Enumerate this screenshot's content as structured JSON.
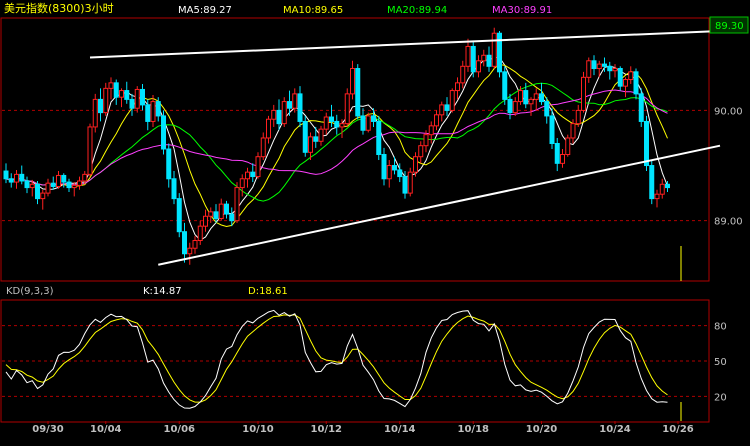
{
  "header": {
    "title": "美元指数(8300)3小时",
    "ma_labels": [
      {
        "text": "MA5:89.27",
        "color": "#ffffff"
      },
      {
        "text": "MA10:89.65",
        "color": "#ffff00"
      },
      {
        "text": "MA20:89.94",
        "color": "#00ff00"
      },
      {
        "text": "MA30:89.91",
        "color": "#ff40ff"
      }
    ]
  },
  "kd": {
    "label": "KD(9,3,3)",
    "k_label": "K:14.87",
    "d_label": "D:18.61"
  },
  "colors": {
    "background": "#000000",
    "frame": "#b00000",
    "grid": "#b00000",
    "axis_text": "#c0c0c0",
    "up_candle": "#ff2020",
    "down_candle": "#00e5ff",
    "ma5": "#ffffff",
    "ma10": "#ffff00",
    "ma20": "#00ff00",
    "ma30": "#ff40ff",
    "trendline": "#ffffff",
    "k_line": "#ffffff",
    "d_line": "#ffff00",
    "volume_bar": "#ffff00"
  },
  "chart_data": [
    {
      "type": "candlestick",
      "title": "美元指数(8300)3小时",
      "x_ticks": [
        "09/30",
        "10/04",
        "10/06",
        "10/10",
        "10/12",
        "10/14",
        "10/18",
        "10/20",
        "10/24",
        "10/26"
      ],
      "x_tick_index": [
        8,
        19,
        33,
        48,
        61,
        75,
        89,
        102,
        116,
        128
      ],
      "y_ticks": [
        90.0,
        89.0
      ],
      "y_tick_labels": [
        "90.00",
        "89.00"
      ],
      "price_marker": "89.30",
      "ylim": [
        88.48,
        90.82
      ],
      "ohlc": [
        [
          89.45,
          89.52,
          89.34,
          89.38
        ],
        [
          89.38,
          89.43,
          89.3,
          89.35
        ],
        [
          89.35,
          89.46,
          89.29,
          89.42
        ],
        [
          89.42,
          89.5,
          89.33,
          89.36
        ],
        [
          89.36,
          89.4,
          89.25,
          89.3
        ],
        [
          89.3,
          89.37,
          89.22,
          89.33
        ],
        [
          89.33,
          89.36,
          89.15,
          89.2
        ],
        [
          89.2,
          89.28,
          89.1,
          89.25
        ],
        [
          89.25,
          89.38,
          89.22,
          89.34
        ],
        [
          89.34,
          89.4,
          89.28,
          89.31
        ],
        [
          89.31,
          89.45,
          89.29,
          89.41
        ],
        [
          89.41,
          89.43,
          89.3,
          89.35
        ],
        [
          89.35,
          89.38,
          89.26,
          89.3
        ],
        [
          89.3,
          89.35,
          89.22,
          89.32
        ],
        [
          89.32,
          89.4,
          89.28,
          89.36
        ],
        [
          89.36,
          89.45,
          89.33,
          89.42
        ],
        [
          89.42,
          89.88,
          89.4,
          89.85
        ],
        [
          89.85,
          90.15,
          89.8,
          90.1
        ],
        [
          90.1,
          90.2,
          89.9,
          89.98
        ],
        [
          89.98,
          90.25,
          89.95,
          90.2
        ],
        [
          90.2,
          90.3,
          90.1,
          90.25
        ],
        [
          90.25,
          90.28,
          90.05,
          90.12
        ],
        [
          90.12,
          90.2,
          90.03,
          90.18
        ],
        [
          90.18,
          90.26,
          90.06,
          90.1
        ],
        [
          90.1,
          90.15,
          89.95,
          90.02
        ],
        [
          90.02,
          90.22,
          89.98,
          90.19
        ],
        [
          90.19,
          90.24,
          90.0,
          90.05
        ],
        [
          90.05,
          90.1,
          89.82,
          89.9
        ],
        [
          89.9,
          90.14,
          89.85,
          90.08
        ],
        [
          90.08,
          90.12,
          89.9,
          89.95
        ],
        [
          89.95,
          90.0,
          89.6,
          89.65
        ],
        [
          89.65,
          89.7,
          89.3,
          89.38
        ],
        [
          89.38,
          89.45,
          89.15,
          89.2
        ],
        [
          89.2,
          89.25,
          88.85,
          88.9
        ],
        [
          88.9,
          88.98,
          88.62,
          88.7
        ],
        [
          88.7,
          88.8,
          88.6,
          88.75
        ],
        [
          88.75,
          88.86,
          88.7,
          88.82
        ],
        [
          88.82,
          89.0,
          88.78,
          88.95
        ],
        [
          88.95,
          89.1,
          88.9,
          89.04
        ],
        [
          89.04,
          89.12,
          88.98,
          89.08
        ],
        [
          89.08,
          89.15,
          88.98,
          89.02
        ],
        [
          89.02,
          89.2,
          89.0,
          89.15
        ],
        [
          89.15,
          89.18,
          89.02,
          89.06
        ],
        [
          89.06,
          89.12,
          88.95,
          89.0
        ],
        [
          89.0,
          89.35,
          88.98,
          89.3
        ],
        [
          89.3,
          89.42,
          89.22,
          89.38
        ],
        [
          89.38,
          89.48,
          89.3,
          89.44
        ],
        [
          89.44,
          89.52,
          89.35,
          89.4
        ],
        [
          89.4,
          89.62,
          89.38,
          89.58
        ],
        [
          89.58,
          89.8,
          89.55,
          89.75
        ],
        [
          89.75,
          89.95,
          89.7,
          89.92
        ],
        [
          89.92,
          90.05,
          89.85,
          90.0
        ],
        [
          90.0,
          90.1,
          89.82,
          89.88
        ],
        [
          89.88,
          90.12,
          89.85,
          90.08
        ],
        [
          90.08,
          90.18,
          89.95,
          90.02
        ],
        [
          90.02,
          90.2,
          89.98,
          90.15
        ],
        [
          90.15,
          90.22,
          89.85,
          89.9
        ],
        [
          89.9,
          89.95,
          89.58,
          89.62
        ],
        [
          89.62,
          89.8,
          89.55,
          89.76
        ],
        [
          89.76,
          89.85,
          89.66,
          89.72
        ],
        [
          89.72,
          89.86,
          89.68,
          89.83
        ],
        [
          89.83,
          89.98,
          89.78,
          89.94
        ],
        [
          89.94,
          90.05,
          89.85,
          89.9
        ],
        [
          89.9,
          89.96,
          89.78,
          89.85
        ],
        [
          89.85,
          89.92,
          89.75,
          89.88
        ],
        [
          89.88,
          90.2,
          89.85,
          90.15
        ],
        [
          90.15,
          90.45,
          90.1,
          90.38
        ],
        [
          90.38,
          90.42,
          89.92,
          89.95
        ],
        [
          89.95,
          90.02,
          89.78,
          89.82
        ],
        [
          89.82,
          89.98,
          89.8,
          89.95
        ],
        [
          89.95,
          90.02,
          89.85,
          89.9
        ],
        [
          89.9,
          89.95,
          89.55,
          89.6
        ],
        [
          89.6,
          89.66,
          89.32,
          89.38
        ],
        [
          89.38,
          89.55,
          89.3,
          89.5
        ],
        [
          89.5,
          89.58,
          89.42,
          89.46
        ],
        [
          89.46,
          89.52,
          89.35,
          89.4
        ],
        [
          89.4,
          89.45,
          89.2,
          89.25
        ],
        [
          89.25,
          89.48,
          89.22,
          89.44
        ],
        [
          89.44,
          89.62,
          89.4,
          89.58
        ],
        [
          89.58,
          89.72,
          89.52,
          89.68
        ],
        [
          89.68,
          89.82,
          89.62,
          89.78
        ],
        [
          89.78,
          89.9,
          89.7,
          89.86
        ],
        [
          89.86,
          90.0,
          89.82,
          89.96
        ],
        [
          89.96,
          90.08,
          89.9,
          90.05
        ],
        [
          90.05,
          90.12,
          89.95,
          90.0
        ],
        [
          90.0,
          90.2,
          89.98,
          90.18
        ],
        [
          90.18,
          90.3,
          90.1,
          90.25
        ],
        [
          90.25,
          90.45,
          90.2,
          90.4
        ],
        [
          90.4,
          90.65,
          90.35,
          90.58
        ],
        [
          90.58,
          90.62,
          90.3,
          90.35
        ],
        [
          90.35,
          90.5,
          90.3,
          90.45
        ],
        [
          90.45,
          90.55,
          90.4,
          90.5
        ],
        [
          90.5,
          90.58,
          90.35,
          90.4
        ],
        [
          90.4,
          90.75,
          90.38,
          90.7
        ],
        [
          90.7,
          90.72,
          90.3,
          90.35
        ],
        [
          90.35,
          90.4,
          90.05,
          90.1
        ],
        [
          90.1,
          90.15,
          89.92,
          89.98
        ],
        [
          89.98,
          90.12,
          89.95,
          90.08
        ],
        [
          90.08,
          90.22,
          90.05,
          90.18
        ],
        [
          90.18,
          90.25,
          90.02,
          90.06
        ],
        [
          90.06,
          90.12,
          89.95,
          90.1
        ],
        [
          90.1,
          90.2,
          90.0,
          90.15
        ],
        [
          90.15,
          90.25,
          90.05,
          90.08
        ],
        [
          90.08,
          90.12,
          89.88,
          89.95
        ],
        [
          89.95,
          90.02,
          89.65,
          89.7
        ],
        [
          89.7,
          89.75,
          89.45,
          89.52
        ],
        [
          89.52,
          89.65,
          89.48,
          89.6
        ],
        [
          89.6,
          89.78,
          89.58,
          89.75
        ],
        [
          89.75,
          89.92,
          89.7,
          89.88
        ],
        [
          89.88,
          90.05,
          89.85,
          90.0
        ],
        [
          90.0,
          90.35,
          89.98,
          90.3
        ],
        [
          90.3,
          90.48,
          90.25,
          90.45
        ],
        [
          90.45,
          90.5,
          90.32,
          90.38
        ],
        [
          90.38,
          90.45,
          90.3,
          90.42
        ],
        [
          90.42,
          90.48,
          90.35,
          90.4
        ],
        [
          90.4,
          90.44,
          90.28,
          90.36
        ],
        [
          90.36,
          90.42,
          90.3,
          90.38
        ],
        [
          90.38,
          90.4,
          90.18,
          90.22
        ],
        [
          90.22,
          90.3,
          90.12,
          90.28
        ],
        [
          90.28,
          90.4,
          90.24,
          90.35
        ],
        [
          90.35,
          90.38,
          90.1,
          90.15
        ],
        [
          90.15,
          90.2,
          89.85,
          89.9
        ],
        [
          89.9,
          89.95,
          89.45,
          89.5
        ],
        [
          89.5,
          89.55,
          89.15,
          89.2
        ],
        [
          89.2,
          89.28,
          89.12,
          89.24
        ],
        [
          89.24,
          89.38,
          89.2,
          89.33
        ],
        [
          89.33,
          89.36,
          89.26,
          89.3
        ]
      ],
      "ma_series": [
        {
          "name": "MA5",
          "period": 5,
          "last": 89.27
        },
        {
          "name": "MA10",
          "period": 10,
          "last": 89.65
        },
        {
          "name": "MA20",
          "period": 20,
          "last": 89.94
        },
        {
          "name": "MA30",
          "period": 30,
          "last": 89.91
        }
      ],
      "trendlines": [
        {
          "x1": 16,
          "y1": 90.48,
          "x2": 136,
          "y2": 90.72
        },
        {
          "x1": 29,
          "y1": 88.6,
          "x2": 136,
          "y2": 89.68
        }
      ]
    },
    {
      "type": "line",
      "title": "KD(9,3,3)",
      "y_ticks": [
        80,
        50,
        20
      ],
      "ylim": [
        0,
        100
      ],
      "series": [
        {
          "name": "K",
          "last": 14.87
        },
        {
          "name": "D",
          "last": 18.61
        }
      ],
      "grid": true
    }
  ]
}
